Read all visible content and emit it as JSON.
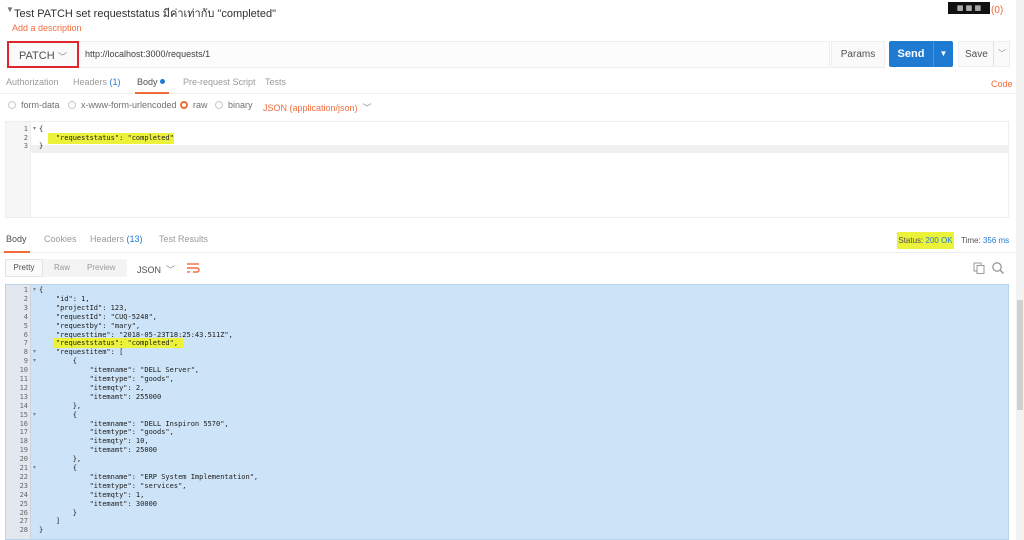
{
  "window": {
    "title": "Test PATCH set requeststatus มีค่าเท่ากับ \"completed\"",
    "add_description": "Add a description",
    "badge": "(0)"
  },
  "request": {
    "method": "PATCH",
    "url": "http://localhost:3000/requests/1",
    "params_label": "Params",
    "send_label": "Send",
    "save_label": "Save"
  },
  "request_tabs": [
    {
      "label": "Authorization"
    },
    {
      "label": "Headers",
      "count": "(1)"
    },
    {
      "label": "Body"
    },
    {
      "label": "Pre-request Script"
    },
    {
      "label": "Tests"
    }
  ],
  "code_link": "Code",
  "body_types": [
    {
      "label": "form-data",
      "selected": false
    },
    {
      "label": "x-www-form-urlencoded",
      "selected": false
    },
    {
      "label": "raw",
      "selected": true
    },
    {
      "label": "binary",
      "selected": false
    }
  ],
  "content_type": "JSON (application/json)",
  "request_body": [
    {
      "n": "1",
      "fold": true,
      "text": "{"
    },
    {
      "n": "2",
      "fold": false,
      "text": "    \"requeststatus\": \"completed\""
    },
    {
      "n": "3",
      "fold": false,
      "text": "}"
    }
  ],
  "response_tabs": [
    {
      "label": "Body"
    },
    {
      "label": "Cookies"
    },
    {
      "label": "Headers",
      "count": "(13)"
    },
    {
      "label": "Test Results"
    }
  ],
  "status": {
    "label": "Status:",
    "value": "200 OK"
  },
  "time": {
    "label": "Time:",
    "value": "356 ms"
  },
  "view_modes": [
    "Pretty",
    "Raw",
    "Preview"
  ],
  "format": "JSON",
  "response_body": [
    {
      "n": "1",
      "fold": true,
      "text": "{"
    },
    {
      "n": "2",
      "fold": false,
      "text": "    \"id\": 1,"
    },
    {
      "n": "3",
      "fold": false,
      "text": "    \"projectId\": 123,"
    },
    {
      "n": "4",
      "fold": false,
      "text": "    \"requestId\": \"CUQ-5248\","
    },
    {
      "n": "5",
      "fold": false,
      "text": "    \"requestby\": \"mary\","
    },
    {
      "n": "6",
      "fold": false,
      "text": "    \"requesttime\": \"2018-05-23T18:25:43.511Z\","
    },
    {
      "n": "7",
      "fold": false,
      "text": "    \"requeststatus\": \"completed\","
    },
    {
      "n": "8",
      "fold": true,
      "text": "    \"requestitem\": ["
    },
    {
      "n": "9",
      "fold": true,
      "text": "        {"
    },
    {
      "n": "10",
      "fold": false,
      "text": "            \"itemname\": \"DELL Server\","
    },
    {
      "n": "11",
      "fold": false,
      "text": "            \"itemtype\": \"goods\","
    },
    {
      "n": "12",
      "fold": false,
      "text": "            \"itemqty\": 2,"
    },
    {
      "n": "13",
      "fold": false,
      "text": "            \"itemamt\": 255000"
    },
    {
      "n": "14",
      "fold": false,
      "text": "        },"
    },
    {
      "n": "15",
      "fold": true,
      "text": "        {"
    },
    {
      "n": "16",
      "fold": false,
      "text": "            \"itemname\": \"DELL Inspiron 5570\","
    },
    {
      "n": "17",
      "fold": false,
      "text": "            \"itemtype\": \"goods\","
    },
    {
      "n": "18",
      "fold": false,
      "text": "            \"itemqty\": 10,"
    },
    {
      "n": "19",
      "fold": false,
      "text": "            \"itemamt\": 25000"
    },
    {
      "n": "20",
      "fold": false,
      "text": "        },"
    },
    {
      "n": "21",
      "fold": true,
      "text": "        {"
    },
    {
      "n": "22",
      "fold": false,
      "text": "            \"itemname\": \"ERP System Implementation\","
    },
    {
      "n": "23",
      "fold": false,
      "text": "            \"itemtype\": \"services\","
    },
    {
      "n": "24",
      "fold": false,
      "text": "            \"itemqty\": 1,"
    },
    {
      "n": "25",
      "fold": false,
      "text": "            \"itemamt\": 30000"
    },
    {
      "n": "26",
      "fold": false,
      "text": "        }"
    },
    {
      "n": "27",
      "fold": false,
      "text": "    ]"
    },
    {
      "n": "28",
      "fold": false,
      "text": "}"
    }
  ],
  "colors": {
    "accent": "#f26b3a",
    "send_button": "#1f7ad2",
    "highlight": "#ecf23a",
    "method_outline": "#e0262d",
    "response_selection": "#cde3f7"
  }
}
